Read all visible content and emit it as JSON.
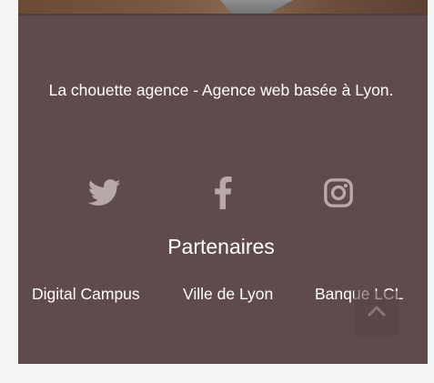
{
  "footer": {
    "tagline": "La chouette agence - Agence web basée à Lyon.",
    "social": [
      {
        "icon": "twitter-icon"
      },
      {
        "icon": "facebook-icon"
      },
      {
        "icon": "instagram-icon"
      }
    ],
    "partners_title": "Partenaires",
    "partners": [
      "Digital Campus",
      "Ville de Lyon",
      "Banque LCL"
    ]
  },
  "back_to_top": {
    "icon": "chevron-up-icon"
  },
  "colors": {
    "footer_background": "#5f4b4b",
    "icon_color": "#b7a9a9",
    "text_color": "#ffffff",
    "page_background": "#f3f4f4"
  }
}
